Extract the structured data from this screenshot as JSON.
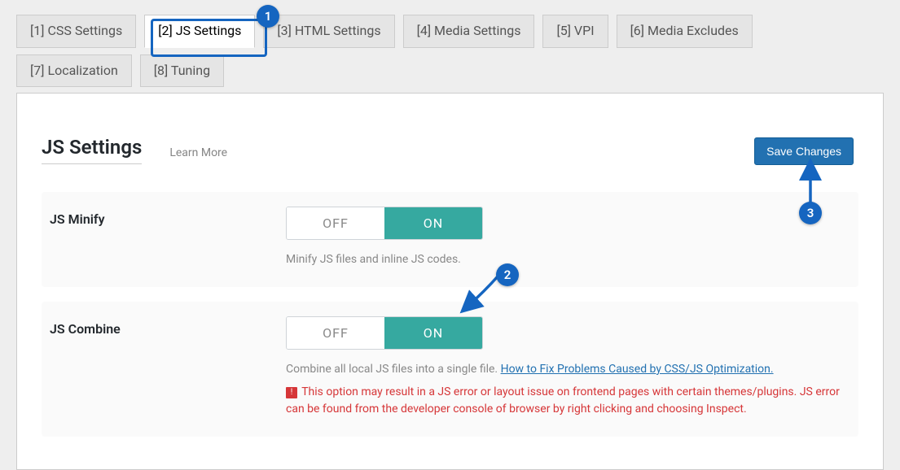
{
  "tabs": {
    "row1": [
      {
        "label": "[1] CSS Settings",
        "active": false
      },
      {
        "label": "[2] JS Settings",
        "active": true
      },
      {
        "label": "[3] HTML Settings",
        "active": false
      },
      {
        "label": "[4] Media Settings",
        "active": false
      },
      {
        "label": "[5] VPI",
        "active": false
      },
      {
        "label": "[6] Media Excludes",
        "active": false
      }
    ],
    "row2": [
      {
        "label": "[7] Localization",
        "active": false
      },
      {
        "label": "[8] Tuning",
        "active": false
      }
    ]
  },
  "header": {
    "title": "JS Settings",
    "learn_more": "Learn More",
    "save": "Save Changes"
  },
  "toggle": {
    "off": "OFF",
    "on": "ON"
  },
  "settings": {
    "minify": {
      "label": "JS Minify",
      "desc": "Minify JS files and inline JS codes."
    },
    "combine": {
      "label": "JS Combine",
      "desc_prefix": "Combine all local JS files into a single file. ",
      "desc_link": "How to Fix Problems Caused by CSS/JS Optimization.",
      "warn": "This option may result in a JS error or layout issue on frontend pages with certain themes/plugins. JS error can be found from the developer console of browser by right clicking and choosing Inspect."
    }
  },
  "callouts": {
    "c1": "1",
    "c2": "2",
    "c3": "3"
  }
}
